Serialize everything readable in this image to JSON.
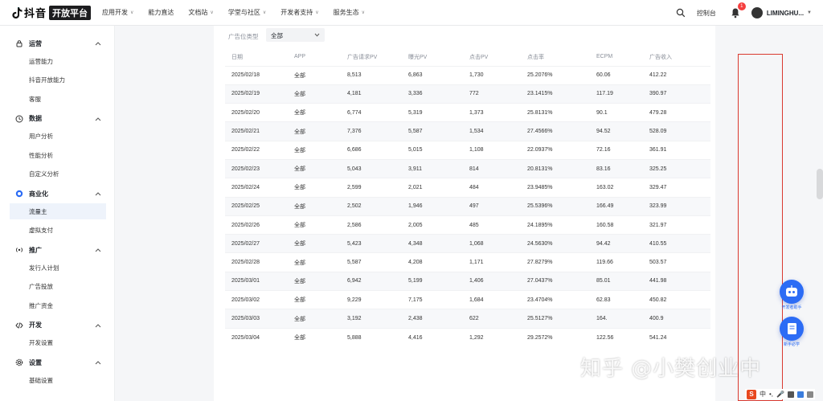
{
  "topbar": {
    "logo_name": "抖音",
    "logo_badge": "开放平台",
    "nav": [
      {
        "label": "应用开发",
        "has_caret": true
      },
      {
        "label": "能力直达",
        "has_caret": false
      },
      {
        "label": "文档站",
        "has_caret": true
      },
      {
        "label": "学堂与社区",
        "has_caret": true
      },
      {
        "label": "开发者支持",
        "has_caret": true
      },
      {
        "label": "服务生态",
        "has_caret": true
      }
    ],
    "console": "控制台",
    "notification_count": "1",
    "username": "LIMINGHU..."
  },
  "sidebar": {
    "groups": [
      {
        "label": "运营",
        "icon": "lock-icon",
        "items": [
          "运营能力",
          "抖音开放能力",
          "客服"
        ]
      },
      {
        "label": "数据",
        "icon": "clock-icon",
        "items": [
          "用户分析",
          "性能分析",
          "自定义分析"
        ]
      },
      {
        "label": "商业化",
        "icon": "coin-icon",
        "items": [
          "流量主",
          "虚拟支付"
        ]
      },
      {
        "label": "推广",
        "icon": "broadcast-icon",
        "items": [
          "发行人计划",
          "广告投放",
          "推广资金"
        ]
      },
      {
        "label": "开发",
        "icon": "code-icon",
        "items": [
          "开发设置"
        ]
      },
      {
        "label": "设置",
        "icon": "gear-icon",
        "items": [
          "基础设置"
        ]
      }
    ],
    "active_item": "流量主"
  },
  "filter": {
    "label": "广告位类型",
    "value": "全部"
  },
  "table": {
    "columns": [
      "日期",
      "APP",
      "广告请求PV",
      "曝光PV",
      "点击PV",
      "点击率",
      "ECPM",
      "广告收入"
    ],
    "rows": [
      [
        "2025/02/18",
        "全部",
        "8,513",
        "6,863",
        "1,730",
        "25.2076%",
        "60.06",
        "412.22"
      ],
      [
        "2025/02/19",
        "全部",
        "4,181",
        "3,336",
        "772",
        "23.1415%",
        "117.19",
        "390.97"
      ],
      [
        "2025/02/20",
        "全部",
        "6,774",
        "5,319",
        "1,373",
        "25.8131%",
        "90.1",
        "479.28"
      ],
      [
        "2025/02/21",
        "全部",
        "7,376",
        "5,587",
        "1,534",
        "27.4566%",
        "94.52",
        "528.09"
      ],
      [
        "2025/02/22",
        "全部",
        "6,686",
        "5,015",
        "1,108",
        "22.0937%",
        "72.16",
        "361.91"
      ],
      [
        "2025/02/23",
        "全部",
        "5,043",
        "3,911",
        "814",
        "20.8131%",
        "83.16",
        "325.25"
      ],
      [
        "2025/02/24",
        "全部",
        "2,599",
        "2,021",
        "484",
        "23.9485%",
        "163.02",
        "329.47"
      ],
      [
        "2025/02/25",
        "全部",
        "2,502",
        "1,946",
        "497",
        "25.5396%",
        "166.49",
        "323.99"
      ],
      [
        "2025/02/26",
        "全部",
        "2,586",
        "2,005",
        "485",
        "24.1895%",
        "160.58",
        "321.97"
      ],
      [
        "2025/02/27",
        "全部",
        "5,423",
        "4,348",
        "1,068",
        "24.5630%",
        "94.42",
        "410.55"
      ],
      [
        "2025/02/28",
        "全部",
        "5,587",
        "4,208",
        "1,171",
        "27.8279%",
        "119.66",
        "503.57"
      ],
      [
        "2025/03/01",
        "全部",
        "6,942",
        "5,199",
        "1,406",
        "27.0437%",
        "85.01",
        "441.98"
      ],
      [
        "2025/03/02",
        "全部",
        "9,229",
        "7,175",
        "1,684",
        "23.4704%",
        "62.83",
        "450.82"
      ],
      [
        "2025/03/03",
        "全部",
        "3,192",
        "2,438",
        "622",
        "25.5127%",
        "164.",
        "400.9"
      ],
      [
        "2025/03/04",
        "全部",
        "5,888",
        "4,416",
        "1,292",
        "29.2572%",
        "122.56",
        "541.24"
      ]
    ]
  },
  "floating": {
    "assistant_label": "开发者助手",
    "guide_label": "新手必学"
  },
  "watermark": "知乎 @小樊创业中",
  "ime": {
    "logo": "S",
    "mode": "中"
  }
}
